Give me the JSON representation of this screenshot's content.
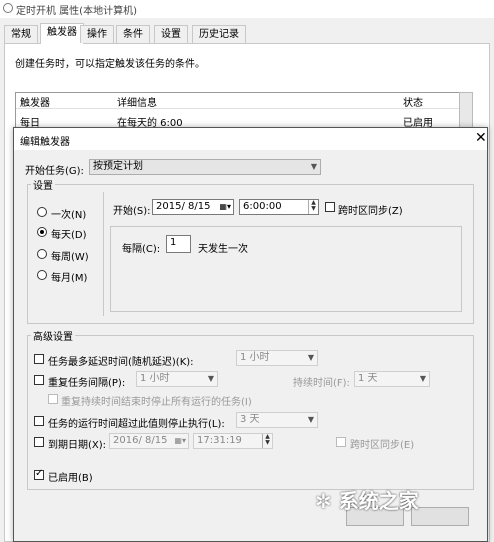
{
  "bg_window": {
    "title": "定时开机 属性(本地计算机)",
    "tabs": [
      "常规",
      "触发器",
      "操作",
      "条件",
      "设置",
      "历史记录"
    ],
    "active_tab": "触发器",
    "description": "创建任务时，可以指定触发该任务的条件。",
    "columns": [
      "触发器",
      "详细信息",
      "状态"
    ],
    "rows": [
      {
        "trigger": "每日",
        "details": "在每天的 6:00",
        "status": "已启用"
      }
    ]
  },
  "dialog": {
    "title": "编辑触发器",
    "close_glyph": "✕",
    "start_task_label": "开始任务(G):",
    "start_task_value": "按预定计划",
    "settings_label": "设置",
    "radio": [
      "一次(N)",
      "每天(D)",
      "每周(W)",
      "每月(M)"
    ],
    "selected_radio": "每天(D)",
    "start_label": "开始(S):",
    "start_date": "2015/ 8/15",
    "start_time": "6:00:00",
    "tz_sync_label": "跨时区同步(Z)",
    "every_label": "每隔(C):",
    "every_value": "1",
    "every_suffix": "天发生一次",
    "advanced_label": "高级设置",
    "delay_label": "任务最多延迟时间(随机延迟)(K):",
    "delay_value": "1 小时",
    "repeat_label": "重复任务间隔(P):",
    "repeat_value": "1 小时",
    "duration_label": "持续时间(F):",
    "duration_value": "1 天",
    "stop_all_label": "重复持续时间结束时停止所有运行的任务(I)",
    "stop_if_label": "任务的运行时间超过此值则停止执行(L):",
    "stop_if_value": "3 天",
    "expire_label": "到期日期(X):",
    "expire_date": "2016/ 8/15",
    "expire_time": "17:31:19",
    "expire_tz_label": "跨时区同步(E)",
    "enabled_label": "已启用(B)"
  },
  "watermark": "系统之家"
}
